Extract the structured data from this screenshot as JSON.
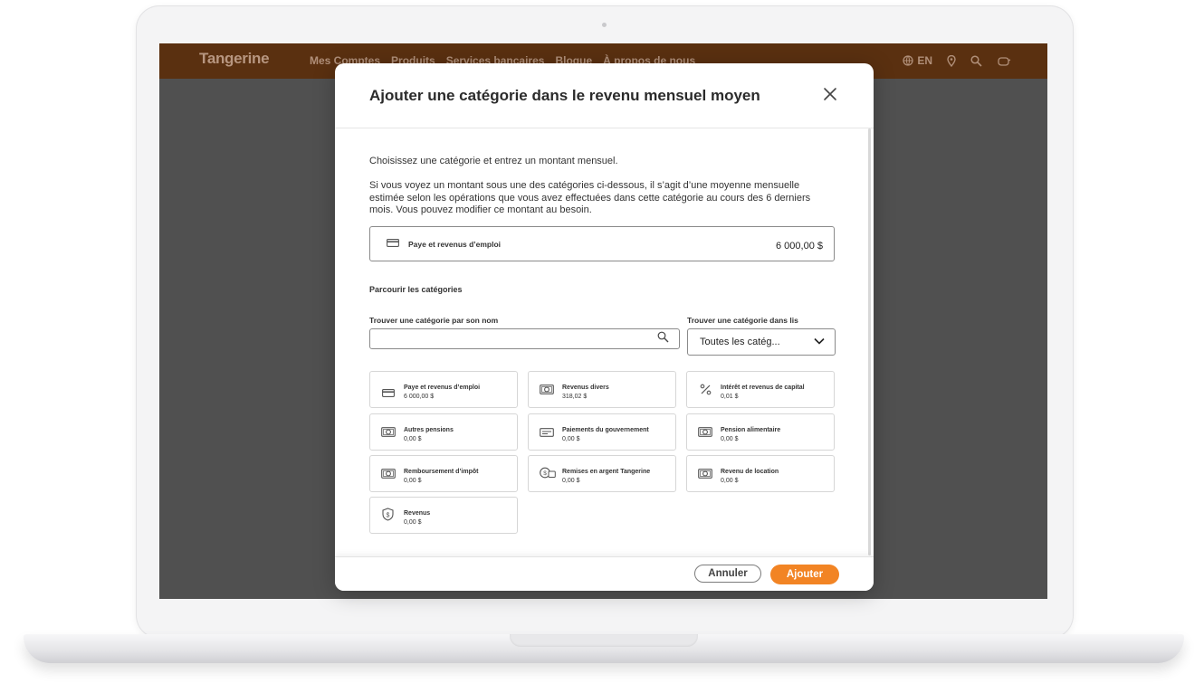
{
  "site": {
    "brand": "Tangerine",
    "nav": [
      "Mes Comptes",
      "Produits",
      "Services bancaires",
      "Blogue",
      "À propos de nous"
    ],
    "language": "EN"
  },
  "modal": {
    "title": "Ajouter une catégorie dans le revenu mensuel moyen",
    "intro": "Choisissez une catégorie et entrez un montant mensuel.",
    "explanation": "Si vous voyez un montant sous une des catégories ci-dessous, il s’agit d’une moyenne mensuelle estimée selon les opérations que vous avez effectuées dans cette catégorie au cours des 6 derniers mois. Vous pouvez modifier ce montant au besoin.",
    "selected": {
      "name": "Paye et revenus d’emploi",
      "amount": "6 000,00 $"
    },
    "browse_title": "Parcourir les catégories",
    "search": {
      "label": "Trouver une catégorie par son nom",
      "value": "",
      "placeholder": ""
    },
    "list_filter": {
      "label": "Trouver une catégorie dans lis",
      "value": "Toutes les catég..."
    },
    "categories": [
      {
        "name": "Paye et revenus d’emploi",
        "amount": "6 000,00 $",
        "icon": "card-icon"
      },
      {
        "name": "Revenus divers",
        "amount": "318,02 $",
        "icon": "cash-icon"
      },
      {
        "name": "Intérêt et revenus de capital",
        "amount": "0,01 $",
        "icon": "percent-icon"
      },
      {
        "name": "Autres pensions",
        "amount": "0,00 $",
        "icon": "cash-icon"
      },
      {
        "name": "Paiements du gouvernement",
        "amount": "0,00 $",
        "icon": "cheque-icon"
      },
      {
        "name": "Pension alimentaire",
        "amount": "0,00 $",
        "icon": "cash-icon"
      },
      {
        "name": "Remboursement d’impôt",
        "amount": "0,00 $",
        "icon": "cash-icon"
      },
      {
        "name": "Remises en argent Tangerine",
        "amount": "0,00 $",
        "icon": "cashback-icon"
      },
      {
        "name": "Revenu de location",
        "amount": "0,00 $",
        "icon": "cash-icon"
      },
      {
        "name": "Revenus",
        "amount": "0,00 $",
        "icon": "shield-dollar-icon"
      }
    ],
    "buttons": {
      "cancel": "Annuler",
      "add": "Ajouter"
    },
    "accent_color": "#f28424"
  }
}
